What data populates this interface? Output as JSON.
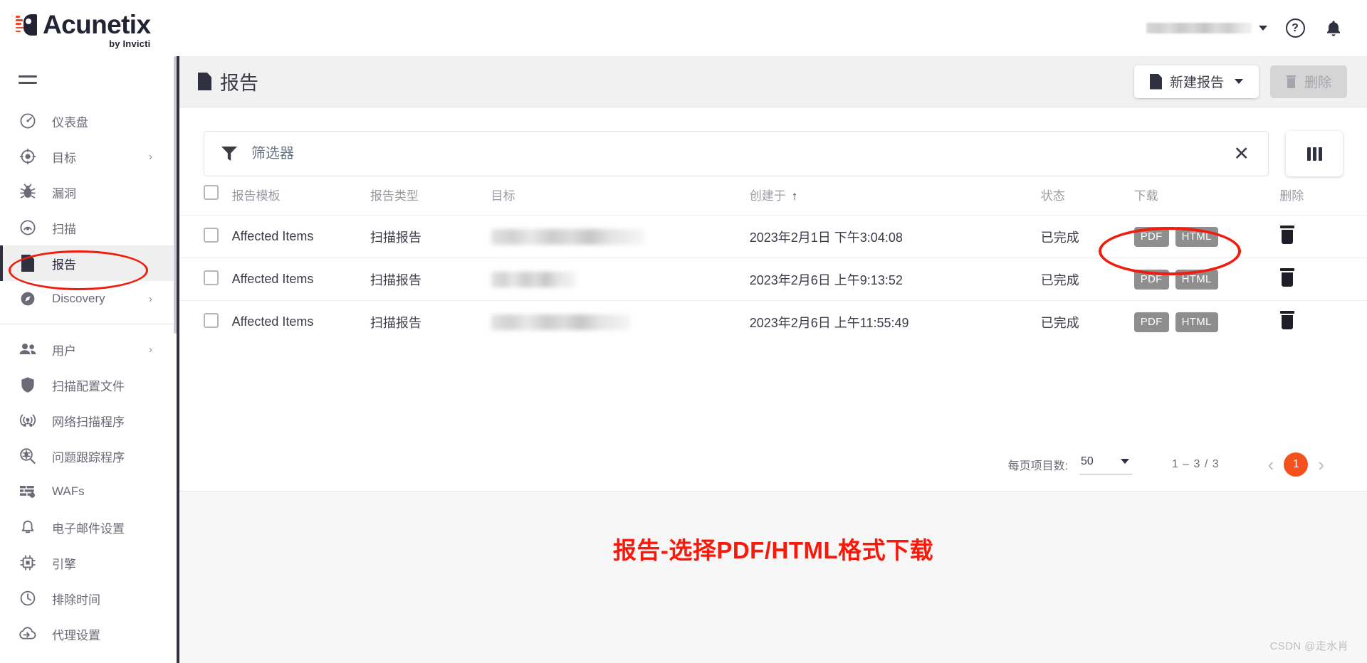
{
  "brand": {
    "name": "Acunetix",
    "tagline": "by Invicti"
  },
  "topbar": {
    "account_name_masked": "",
    "help_glyph": "?",
    "help_label": "help",
    "notifications_label": "notifications"
  },
  "sidebar": {
    "menu_label": "menu",
    "groups": [
      {
        "items": [
          {
            "label": "仪表盘",
            "icon": "dashboard-icon",
            "chevron": ""
          },
          {
            "label": "目标",
            "icon": "target-icon",
            "chevron": "›"
          },
          {
            "label": "漏洞",
            "icon": "bug-icon",
            "chevron": ""
          },
          {
            "label": "扫描",
            "icon": "scan-icon",
            "chevron": ""
          },
          {
            "label": "报告",
            "icon": "report-document-icon",
            "chevron": "",
            "active": true
          },
          {
            "label": "Discovery",
            "icon": "compass-icon",
            "chevron": "›"
          }
        ]
      },
      {
        "items": [
          {
            "label": "用户",
            "icon": "users-icon",
            "chevron": "›"
          },
          {
            "label": "扫描配置文件",
            "icon": "shield-icon",
            "chevron": ""
          },
          {
            "label": "网络扫描程序",
            "icon": "network-scanner-icon",
            "chevron": ""
          },
          {
            "label": "问题跟踪程序",
            "icon": "issue-tracker-icon",
            "chevron": ""
          },
          {
            "label": "WAFs",
            "icon": "waf-icon",
            "chevron": ""
          },
          {
            "label": "电子邮件设置",
            "icon": "bell-icon",
            "chevron": ""
          },
          {
            "label": "引擎",
            "icon": "engine-chip-icon",
            "chevron": ""
          },
          {
            "label": "排除时间",
            "icon": "clock-icon",
            "chevron": ""
          },
          {
            "label": "代理设置",
            "icon": "cloud-proxy-icon",
            "chevron": ""
          }
        ]
      }
    ]
  },
  "page": {
    "title": "报告",
    "title_icon": "document-icon",
    "actions": {
      "new_report": "新建报告",
      "new_report_icon": "document-icon",
      "delete": "删除",
      "delete_icon": "trash-icon"
    }
  },
  "filter": {
    "placeholder": "筛选器",
    "value": "",
    "icon": "funnel-icon",
    "clear_icon": "close-icon",
    "columns_icon": "columns-icon"
  },
  "table": {
    "select_all_checkbox": false,
    "sort_column": "创建于",
    "sort_direction": "↑",
    "columns": [
      {
        "key": "checkbox",
        "label": ""
      },
      {
        "key": "template",
        "label": "报告模板"
      },
      {
        "key": "type",
        "label": "报告类型"
      },
      {
        "key": "target",
        "label": "目标"
      },
      {
        "key": "created",
        "label": "创建于"
      },
      {
        "key": "status",
        "label": "状态"
      },
      {
        "key": "download",
        "label": "下载"
      },
      {
        "key": "delete",
        "label": "删除"
      }
    ],
    "rows": [
      {
        "checked": false,
        "template": "Affected Items",
        "type": "扫描报告",
        "target": "",
        "target_masked": true,
        "created": "2023年2月1日 下午3:04:08",
        "status": "已完成",
        "downloads": [
          "PDF",
          "HTML"
        ],
        "delete_icon": "trash-icon"
      },
      {
        "checked": false,
        "template": "Affected Items",
        "type": "扫描报告",
        "target": "",
        "target_masked": true,
        "created": "2023年2月6日 上午9:13:52",
        "status": "已完成",
        "downloads": [
          "PDF",
          "HTML"
        ],
        "delete_icon": "trash-icon"
      },
      {
        "checked": false,
        "template": "Affected Items",
        "type": "扫描报告",
        "target": "",
        "target_masked": true,
        "created": "2023年2月6日 上午11:55:49",
        "status": "已完成",
        "downloads": [
          "PDF",
          "HTML"
        ],
        "delete_icon": "trash-icon"
      }
    ]
  },
  "paginator": {
    "items_per_page_label": "每页项目数:",
    "items_per_page_value": "50",
    "range": "1 – 3 / 3",
    "prev_glyph": "‹",
    "next_glyph": "›",
    "current_page": "1"
  },
  "annotations": {
    "caption": "报告-选择PDF/HTML格式下载",
    "caption_color": "#fb170a",
    "ellipse_color": "#f01c0e"
  },
  "watermark": "CSDN @走水肖"
}
